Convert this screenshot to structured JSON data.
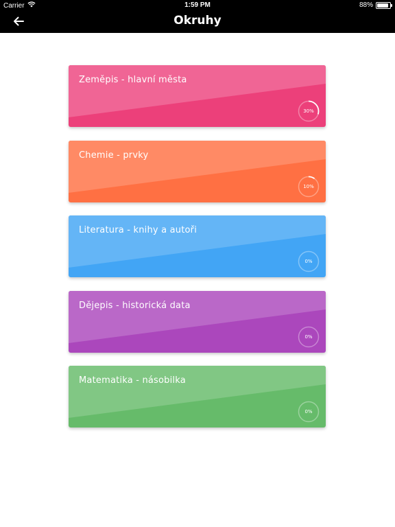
{
  "status_bar": {
    "carrier": "Carrier",
    "time": "1:59 PM",
    "battery": "88%",
    "battery_level": 0.88
  },
  "nav": {
    "title": "Okruhy",
    "back_icon": "arrow-left-icon"
  },
  "cards": [
    {
      "id": "zemepis",
      "title": "Zeměpis - hlavní města",
      "progress_label": "30%",
      "progress": 0.3,
      "color_light": "#f06595",
      "color_dark": "#ec407a"
    },
    {
      "id": "chemie",
      "title": "Chemie - prvky",
      "progress_label": "10%",
      "progress": 0.1,
      "color_light": "#ff8a65",
      "color_dark": "#ff7043"
    },
    {
      "id": "literatura",
      "title": "Literatura - knihy a autoři",
      "progress_label": "0%",
      "progress": 0.0,
      "color_light": "#64b5f6",
      "color_dark": "#42a5f5"
    },
    {
      "id": "dejepis",
      "title": "Dějepis - historická data",
      "progress_label": "0%",
      "progress": 0.0,
      "color_light": "#ba68c8",
      "color_dark": "#ab47bc"
    },
    {
      "id": "matematika",
      "title": "Matematika - násobilka",
      "progress_label": "0%",
      "progress": 0.0,
      "color_light": "#81c784",
      "color_dark": "#66bb6a"
    }
  ]
}
